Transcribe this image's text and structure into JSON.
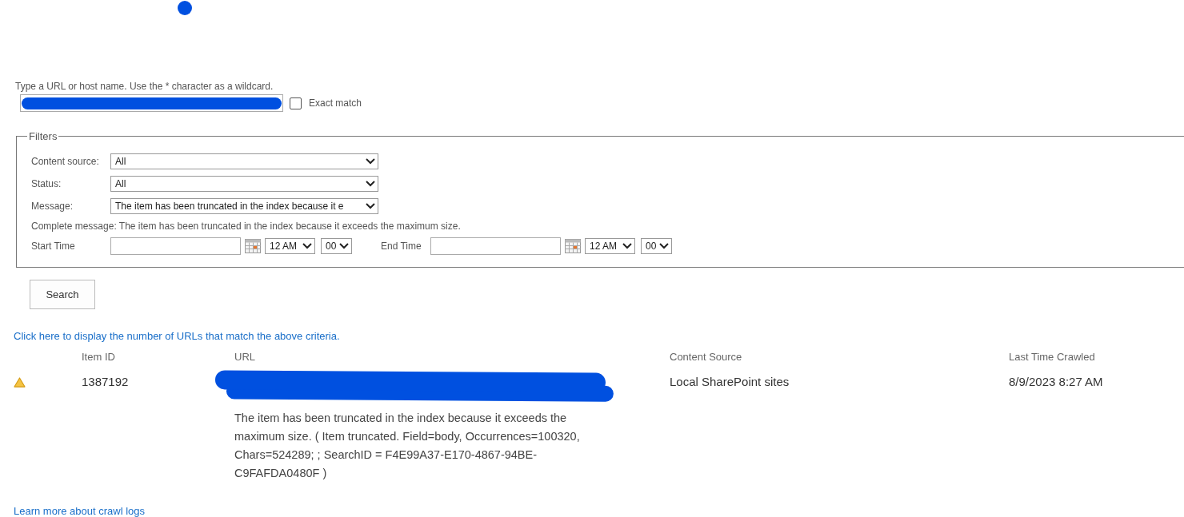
{
  "url_filter": {
    "hint": "Type a URL or host name. Use the * character as a wildcard.",
    "exact_match": {
      "label": "Exact match",
      "checked": false
    }
  },
  "filters": {
    "legend": "Filters",
    "fields": [
      {
        "label": "Content source:",
        "value": "All"
      },
      {
        "label": "Status:",
        "value": "All"
      },
      {
        "label": "Message:",
        "value": "The item has been truncated in the index because it e"
      }
    ],
    "complete_message": "Complete message: The item has been truncated in the index because it exceeds the maximum size.",
    "times": [
      {
        "label": "Start Time",
        "hour": "12 AM",
        "minute": "00"
      },
      {
        "label": "End Time",
        "hour": "12 AM",
        "minute": "00"
      }
    ]
  },
  "search_button": "Search",
  "count_link": "Click here to display the number of URLs that match the above criteria.",
  "table": {
    "columns": [
      "Item ID",
      "URL",
      "Content Source",
      "Last Time Crawled"
    ],
    "rows": [
      {
        "warning": true,
        "item_id": "1387192",
        "message": "The item has been truncated in the index because it exceeds the maximum size. ( Item truncated. Field=body, Occurrences=100320, Chars=524289; ; SearchID = F4E99A37-E170-4867-94BE-C9FAFDA0480F )",
        "content_source": "Local SharePoint sites",
        "last_crawled": "8/9/2023 8:27 AM"
      }
    ]
  },
  "footer_link": "Learn more about crawl logs"
}
